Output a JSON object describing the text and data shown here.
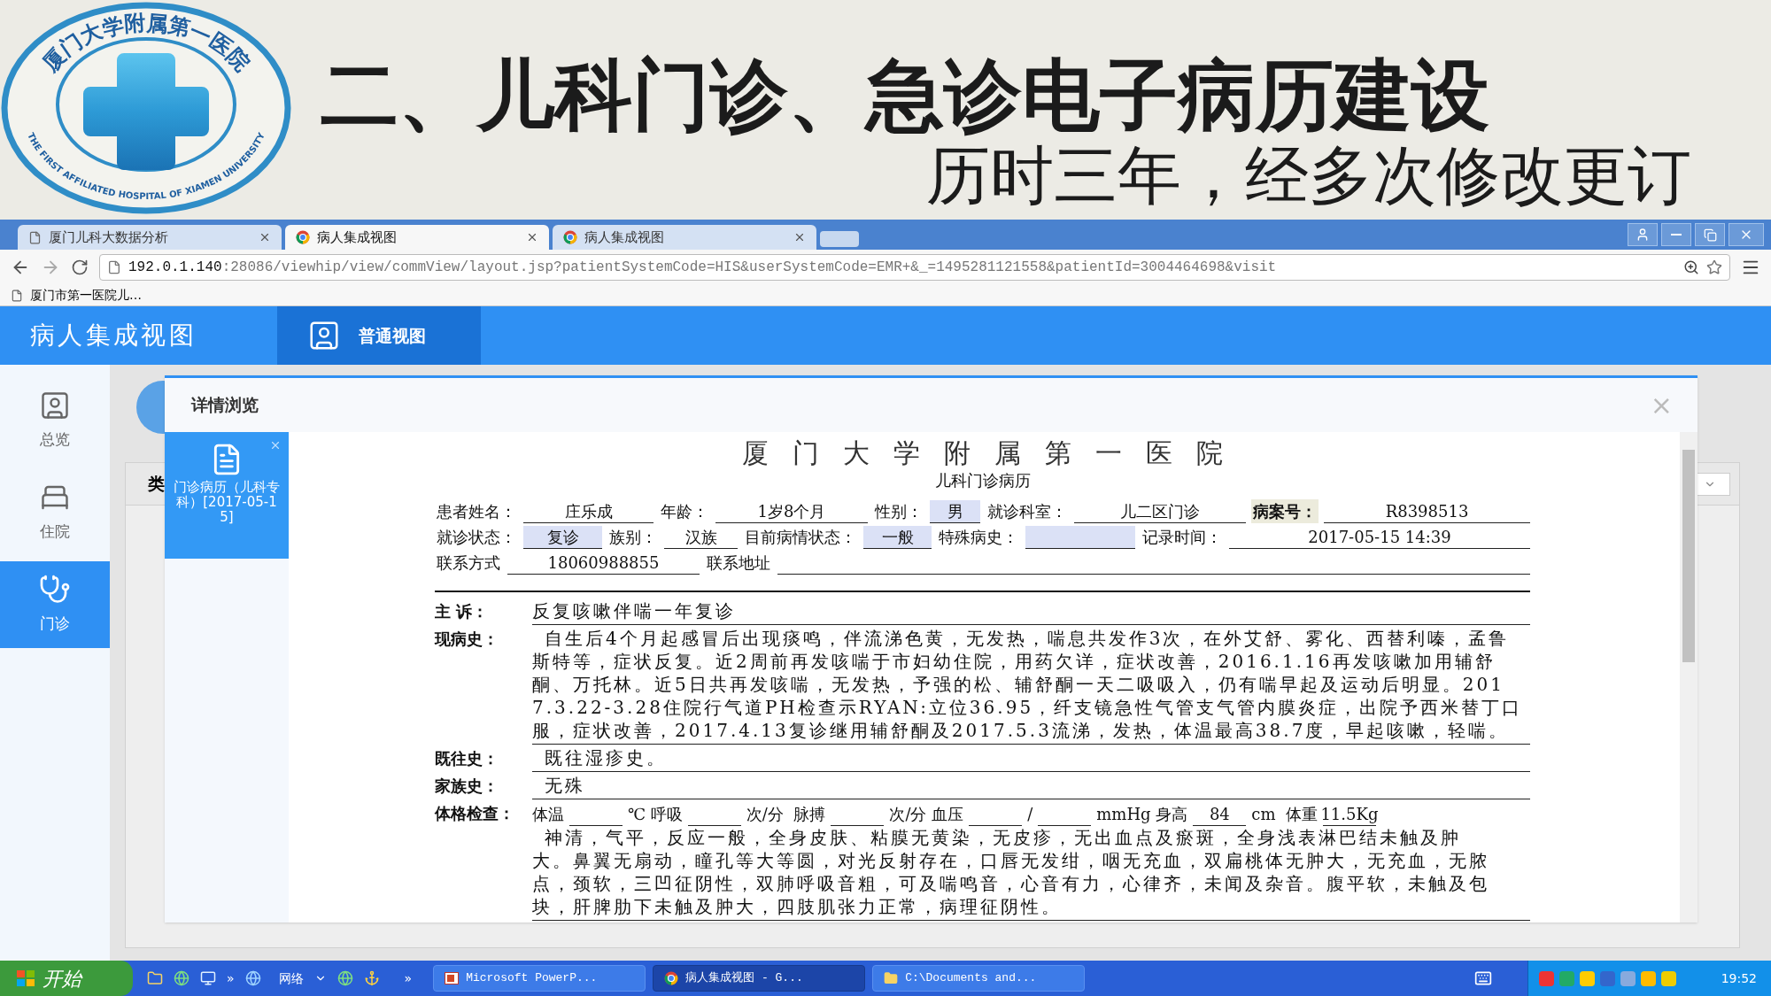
{
  "slide": {
    "logo": {
      "chinese": "厦门大学附属第一医院",
      "english": "THE FIRST AFFILIATED HOSPITAL OF XIAMEN UNIVERSITY"
    },
    "title": "二、儿科门诊、急诊电子病历建设",
    "subtitle": "历时三年，经多次修改更订"
  },
  "browser": {
    "tabs": [
      {
        "label": "厦门儿科大数据分析",
        "selected": false,
        "kind": "page"
      },
      {
        "label": "病人集成视图",
        "selected": true,
        "kind": "app"
      },
      {
        "label": "病人集成视图",
        "selected": false,
        "kind": "app"
      }
    ],
    "url_host": "192.0.1.140",
    "url_rest": ":28086/viewhip/view/commView/layout.jsp?patientSystemCode=HIS&userSystemCode=EMR+&_=1495281121558&patientId=3004464698&visit",
    "bookmarks": [
      "厦门市第一医院儿…"
    ]
  },
  "app": {
    "title": "病人集成视图",
    "view_tab": "普通视图",
    "sidebar": [
      {
        "label": "总览",
        "kind": "overview",
        "selected": false
      },
      {
        "label": "住院",
        "kind": "inpatient",
        "selected": false
      },
      {
        "label": "门诊",
        "kind": "outpatient",
        "selected": true
      }
    ],
    "background_text": "类"
  },
  "dialog": {
    "title": "详情浏览",
    "close": "×",
    "records": [
      {
        "label": "门诊病历（儿科专科）[2017-05-15]",
        "selected": true
      }
    ],
    "document": {
      "hospital": "厦门大学附属第一医院",
      "form_title": "儿科门诊病历",
      "info_rows": [
        {
          "fields": [
            {
              "label": "患者姓名：",
              "value": "庄乐成",
              "highlight": false,
              "emphasis": false
            },
            {
              "label": "年龄：",
              "value": "1岁8个月",
              "highlight": false,
              "emphasis": false
            },
            {
              "label": "性别：",
              "value": "男",
              "highlight": true,
              "emphasis": false
            },
            {
              "label": "就诊科室：",
              "value": "儿二区门诊",
              "highlight": false,
              "emphasis": false
            },
            {
              "label": "病案号：",
              "value": "R8398513",
              "highlight": false,
              "emphasis": true
            }
          ]
        },
        {
          "fields": [
            {
              "label": "就诊状态：",
              "value": "复诊",
              "highlight": true,
              "emphasis": false
            },
            {
              "label": "族别：",
              "value": "汉族",
              "highlight": false,
              "emphasis": false
            },
            {
              "label": "目前病情状态：",
              "value": "一般",
              "highlight": true,
              "emphasis": false
            },
            {
              "label": "特殊病史：",
              "highlight": true,
              "emphasis": false
            },
            {
              "label": "记录时间：",
              "value": "2017-05-15 14:39",
              "highlight": false,
              "emphasis": false
            }
          ]
        },
        {
          "fields": [
            {
              "label": "联系方式",
              "value": "18060988855",
              "highlight": false,
              "emphasis": false
            },
            {
              "label": "联系地址",
              "highlight": false,
              "emphasis": false
            }
          ]
        }
      ],
      "sections": [
        {
          "label": "主 诉：",
          "kind": "text",
          "lines": [
            "反复咳嗽伴喘一年复诊"
          ]
        },
        {
          "label": "现病史：",
          "kind": "text",
          "lines": [
            "自生后4个月起感冒后出现痰鸣，伴流涕色黄，无发热，喘息共发作3次，在外艾舒、雾化、西替利嗪，孟鲁",
            "斯特等，症状反复。近2周前再发咳喘于市妇幼住院，用药欠详，症状改善，2016.1.16再发咳嗽加用辅舒",
            "酮、万托林。近5日共再发咳喘，无发热，予强的松、辅舒酮一天二吸吸入，仍有喘早起及运动后明显。201",
            "7.3.22-3.28住院行气道PH检查示RYAN:立位36.95，纤支镜急性气管支气管内膜炎症，出院予西米替丁口",
            "服，症状改善，2017.4.13复诊继用辅舒酮及2017.5.3流涕，发热，体温最高38.7度，早起咳嗽，轻喘。"
          ]
        },
        {
          "label": "既往史：",
          "kind": "text",
          "lines": [
            "既往湿疹史。"
          ]
        },
        {
          "label": "家族史：",
          "kind": "text",
          "lines": [
            "无殊"
          ]
        },
        {
          "label": "体格检查：",
          "kind": "vitals",
          "items": [
            {
              "kind": "text",
              "text": "体温"
            },
            {
              "kind": "field"
            },
            {
              "kind": "text",
              "text": "℃ 呼吸"
            },
            {
              "kind": "field"
            },
            {
              "kind": "text",
              "text": "次/分  脉搏"
            },
            {
              "kind": "field"
            },
            {
              "kind": "text",
              "text": "次/分 血压"
            },
            {
              "kind": "field"
            },
            {
              "kind": "text",
              "text": "/"
            },
            {
              "kind": "field"
            },
            {
              "kind": "text",
              "text": "mmHg 身高"
            },
            {
              "kind": "field",
              "value": "84"
            },
            {
              "kind": "text",
              "text": "cm  体重"
            },
            {
              "kind": "field",
              "value": "11.5Kg"
            }
          ],
          "lines": [
            "神清，气平，反应一般，全身皮肤、粘膜无黄染，无皮疹，无出血点及瘀斑，全身浅表淋巴结未触及肿",
            "大。鼻翼无扇动，瞳孔等大等圆，对光反射存在，口唇无发绀，咽无充血，双扁桃体无肿大，无充血，无脓",
            "点，颈软，三凹征阴性，双肺呼吸音粗，可及喘鸣音，心音有力，心律齐，未闻及杂音。腹平软，未触及包",
            "块，肝脾肋下未触及肿大，四肢肌张力正常，病理征阴性。"
          ]
        }
      ]
    }
  },
  "taskbar": {
    "start": "开始",
    "overflow": [
      "»",
      "»"
    ],
    "toolbar_label": "网络",
    "tasks": [
      {
        "label": "Microsoft PowerP...",
        "kind": "powerpoint",
        "selected": false
      },
      {
        "label": "病人集成视图 - G...",
        "kind": "browser",
        "selected": true
      },
      {
        "label": "C:\\Documents and...",
        "kind": "folder",
        "selected": false
      }
    ],
    "clock": "19:52"
  }
}
